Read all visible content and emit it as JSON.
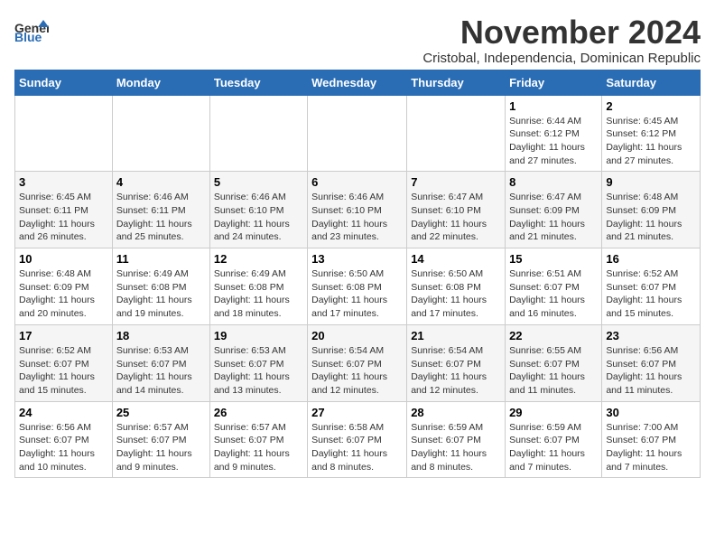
{
  "logo": {
    "general": "General",
    "blue": "Blue"
  },
  "title": {
    "month": "November 2024",
    "subtitle": "Cristobal, Independencia, Dominican Republic"
  },
  "weekdays": [
    "Sunday",
    "Monday",
    "Tuesday",
    "Wednesday",
    "Thursday",
    "Friday",
    "Saturday"
  ],
  "weeks": [
    [
      {
        "day": "",
        "info": ""
      },
      {
        "day": "",
        "info": ""
      },
      {
        "day": "",
        "info": ""
      },
      {
        "day": "",
        "info": ""
      },
      {
        "day": "",
        "info": ""
      },
      {
        "day": "1",
        "info": "Sunrise: 6:44 AM\nSunset: 6:12 PM\nDaylight: 11 hours and 27 minutes."
      },
      {
        "day": "2",
        "info": "Sunrise: 6:45 AM\nSunset: 6:12 PM\nDaylight: 11 hours and 27 minutes."
      }
    ],
    [
      {
        "day": "3",
        "info": "Sunrise: 6:45 AM\nSunset: 6:11 PM\nDaylight: 11 hours and 26 minutes."
      },
      {
        "day": "4",
        "info": "Sunrise: 6:46 AM\nSunset: 6:11 PM\nDaylight: 11 hours and 25 minutes."
      },
      {
        "day": "5",
        "info": "Sunrise: 6:46 AM\nSunset: 6:10 PM\nDaylight: 11 hours and 24 minutes."
      },
      {
        "day": "6",
        "info": "Sunrise: 6:46 AM\nSunset: 6:10 PM\nDaylight: 11 hours and 23 minutes."
      },
      {
        "day": "7",
        "info": "Sunrise: 6:47 AM\nSunset: 6:10 PM\nDaylight: 11 hours and 22 minutes."
      },
      {
        "day": "8",
        "info": "Sunrise: 6:47 AM\nSunset: 6:09 PM\nDaylight: 11 hours and 21 minutes."
      },
      {
        "day": "9",
        "info": "Sunrise: 6:48 AM\nSunset: 6:09 PM\nDaylight: 11 hours and 21 minutes."
      }
    ],
    [
      {
        "day": "10",
        "info": "Sunrise: 6:48 AM\nSunset: 6:09 PM\nDaylight: 11 hours and 20 minutes."
      },
      {
        "day": "11",
        "info": "Sunrise: 6:49 AM\nSunset: 6:08 PM\nDaylight: 11 hours and 19 minutes."
      },
      {
        "day": "12",
        "info": "Sunrise: 6:49 AM\nSunset: 6:08 PM\nDaylight: 11 hours and 18 minutes."
      },
      {
        "day": "13",
        "info": "Sunrise: 6:50 AM\nSunset: 6:08 PM\nDaylight: 11 hours and 17 minutes."
      },
      {
        "day": "14",
        "info": "Sunrise: 6:50 AM\nSunset: 6:08 PM\nDaylight: 11 hours and 17 minutes."
      },
      {
        "day": "15",
        "info": "Sunrise: 6:51 AM\nSunset: 6:07 PM\nDaylight: 11 hours and 16 minutes."
      },
      {
        "day": "16",
        "info": "Sunrise: 6:52 AM\nSunset: 6:07 PM\nDaylight: 11 hours and 15 minutes."
      }
    ],
    [
      {
        "day": "17",
        "info": "Sunrise: 6:52 AM\nSunset: 6:07 PM\nDaylight: 11 hours and 15 minutes."
      },
      {
        "day": "18",
        "info": "Sunrise: 6:53 AM\nSunset: 6:07 PM\nDaylight: 11 hours and 14 minutes."
      },
      {
        "day": "19",
        "info": "Sunrise: 6:53 AM\nSunset: 6:07 PM\nDaylight: 11 hours and 13 minutes."
      },
      {
        "day": "20",
        "info": "Sunrise: 6:54 AM\nSunset: 6:07 PM\nDaylight: 11 hours and 12 minutes."
      },
      {
        "day": "21",
        "info": "Sunrise: 6:54 AM\nSunset: 6:07 PM\nDaylight: 11 hours and 12 minutes."
      },
      {
        "day": "22",
        "info": "Sunrise: 6:55 AM\nSunset: 6:07 PM\nDaylight: 11 hours and 11 minutes."
      },
      {
        "day": "23",
        "info": "Sunrise: 6:56 AM\nSunset: 6:07 PM\nDaylight: 11 hours and 11 minutes."
      }
    ],
    [
      {
        "day": "24",
        "info": "Sunrise: 6:56 AM\nSunset: 6:07 PM\nDaylight: 11 hours and 10 minutes."
      },
      {
        "day": "25",
        "info": "Sunrise: 6:57 AM\nSunset: 6:07 PM\nDaylight: 11 hours and 9 minutes."
      },
      {
        "day": "26",
        "info": "Sunrise: 6:57 AM\nSunset: 6:07 PM\nDaylight: 11 hours and 9 minutes."
      },
      {
        "day": "27",
        "info": "Sunrise: 6:58 AM\nSunset: 6:07 PM\nDaylight: 11 hours and 8 minutes."
      },
      {
        "day": "28",
        "info": "Sunrise: 6:59 AM\nSunset: 6:07 PM\nDaylight: 11 hours and 8 minutes."
      },
      {
        "day": "29",
        "info": "Sunrise: 6:59 AM\nSunset: 6:07 PM\nDaylight: 11 hours and 7 minutes."
      },
      {
        "day": "30",
        "info": "Sunrise: 7:00 AM\nSunset: 6:07 PM\nDaylight: 11 hours and 7 minutes."
      }
    ]
  ]
}
